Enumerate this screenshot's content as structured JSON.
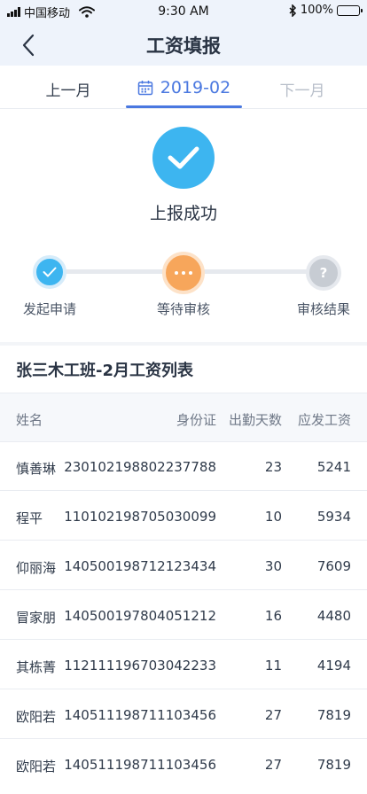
{
  "status_bar": {
    "carrier": "中国移动",
    "time": "9:30 AM",
    "battery": "100%",
    "battery_level": 1.0
  },
  "nav": {
    "title": "工资填报"
  },
  "month_tabs": {
    "prev": "上一月",
    "current": "2019-02",
    "next": "下一月"
  },
  "success": {
    "text": "上报成功"
  },
  "steps": [
    {
      "label": "发起申请"
    },
    {
      "label": "等待审核"
    },
    {
      "label": "审核结果"
    }
  ],
  "section": {
    "title": "张三木工班-2月工资列表"
  },
  "table": {
    "headers": {
      "name": "姓名",
      "id": "身份证",
      "days": "出勤天数",
      "pay": "应发工资"
    },
    "rows": [
      {
        "name": "慎善琳",
        "id": "230102198802237788",
        "days": "23",
        "pay": "5241"
      },
      {
        "name": "程平",
        "id": "110102198705030099",
        "days": "10",
        "pay": "5934"
      },
      {
        "name": "仰丽海",
        "id": "140500198712123434",
        "days": "30",
        "pay": "7609"
      },
      {
        "name": "冒家朋",
        "id": "140500197804051212",
        "days": "16",
        "pay": "4480"
      },
      {
        "name": "其栋菁",
        "id": "112111196703042233",
        "days": "11",
        "pay": "4194"
      },
      {
        "name": "欧阳若",
        "id": "140511198711103456",
        "days": "27",
        "pay": "7819"
      },
      {
        "name": "欧阳若",
        "id": "140511198711103456",
        "days": "27",
        "pay": "7819"
      }
    ]
  },
  "colors": {
    "accent": "#4a78e0",
    "success": "#3db5f0",
    "pending": "#f7a65b",
    "inactive": "#c7ccd3"
  }
}
